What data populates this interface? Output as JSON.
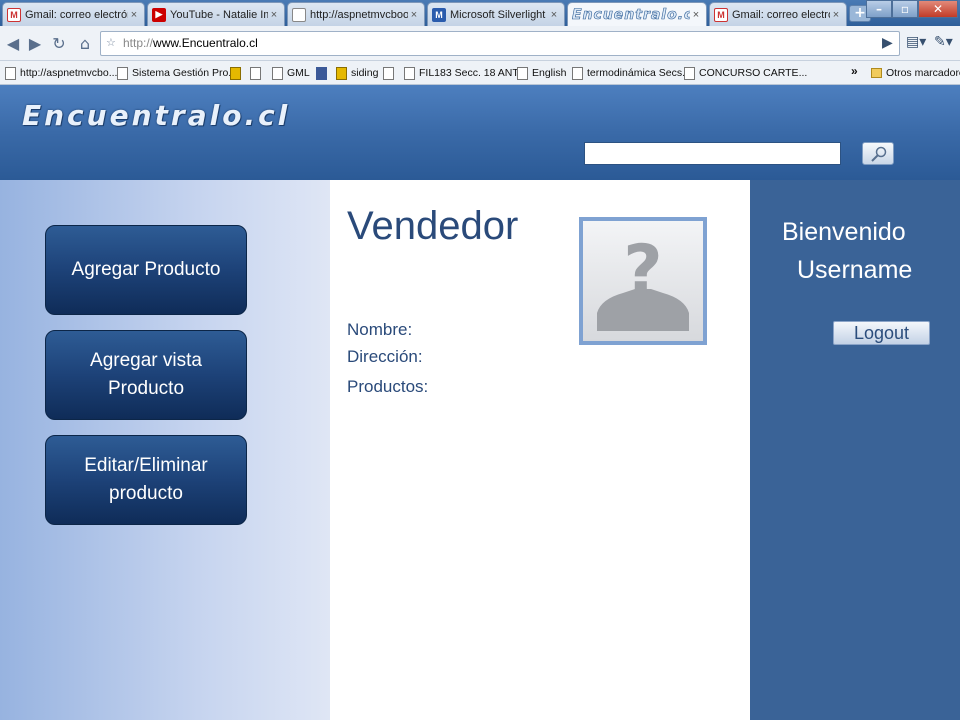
{
  "browser": {
    "tabs": [
      {
        "label": "Gmail: correo electrónic...",
        "favicon": "gmail-icon"
      },
      {
        "label": "YouTube - Natalie Imbr...",
        "favicon": "youtube-icon"
      },
      {
        "label": "http://aspnetmvcbook....",
        "favicon": "page-icon"
      },
      {
        "label": "Microsoft Silverlight",
        "favicon": "silverlight-icon"
      },
      {
        "label": "Encuentralo.cl",
        "favicon": "encuentralo-logo"
      },
      {
        "label": "Gmail: correo electrónic...",
        "favicon": "gmail-icon"
      }
    ],
    "tab_close_glyph": "×",
    "new_tab_glyph": "+",
    "url_scheme": "http://",
    "url_host": "www.Encuentralo.cl",
    "bookmarks": [
      {
        "label": "http://aspnetmvcbo...",
        "icon": "page-icon"
      },
      {
        "label": "Sistema Gestión Pro...",
        "icon": "page-icon"
      },
      {
        "label": "",
        "icon": "gold-icon"
      },
      {
        "label": "",
        "icon": "page-icon"
      },
      {
        "label": "GML",
        "icon": "page-icon"
      },
      {
        "label": "",
        "icon": "facebook-icon"
      },
      {
        "label": "siding",
        "icon": "gold-icon"
      },
      {
        "label": "",
        "icon": "page-icon"
      },
      {
        "label": "FIL183 Secc. 18 ANT...",
        "icon": "page-icon"
      },
      {
        "label": "English",
        "icon": "page-icon"
      },
      {
        "label": "termodinámica Secs...",
        "icon": "page-icon"
      },
      {
        "label": "CONCURSO CARTE...",
        "icon": "page-icon"
      }
    ],
    "bookmarks_more": "»",
    "other_bookmarks": "Otros marcadores"
  },
  "site": {
    "logo": "Encuentralo.cl",
    "search_placeholder": ""
  },
  "sidebar": {
    "buttons": [
      {
        "label": "Agregar Producto"
      },
      {
        "label": "Agregar  vista Producto"
      },
      {
        "label": "Editar/Eliminar producto"
      }
    ]
  },
  "main": {
    "title": "Vendedor",
    "fields": [
      {
        "label": "Nombre:"
      },
      {
        "label": "Dirección:"
      },
      {
        "label": "Productos:"
      }
    ]
  },
  "account": {
    "welcome": "Bienvenido",
    "username": "Username",
    "logout_label": "Logout"
  },
  "colors": {
    "header": "#3a6aa8",
    "right_panel": "#3a6397",
    "nav_button": "#1d4278",
    "title_text": "#2a4a7a"
  }
}
